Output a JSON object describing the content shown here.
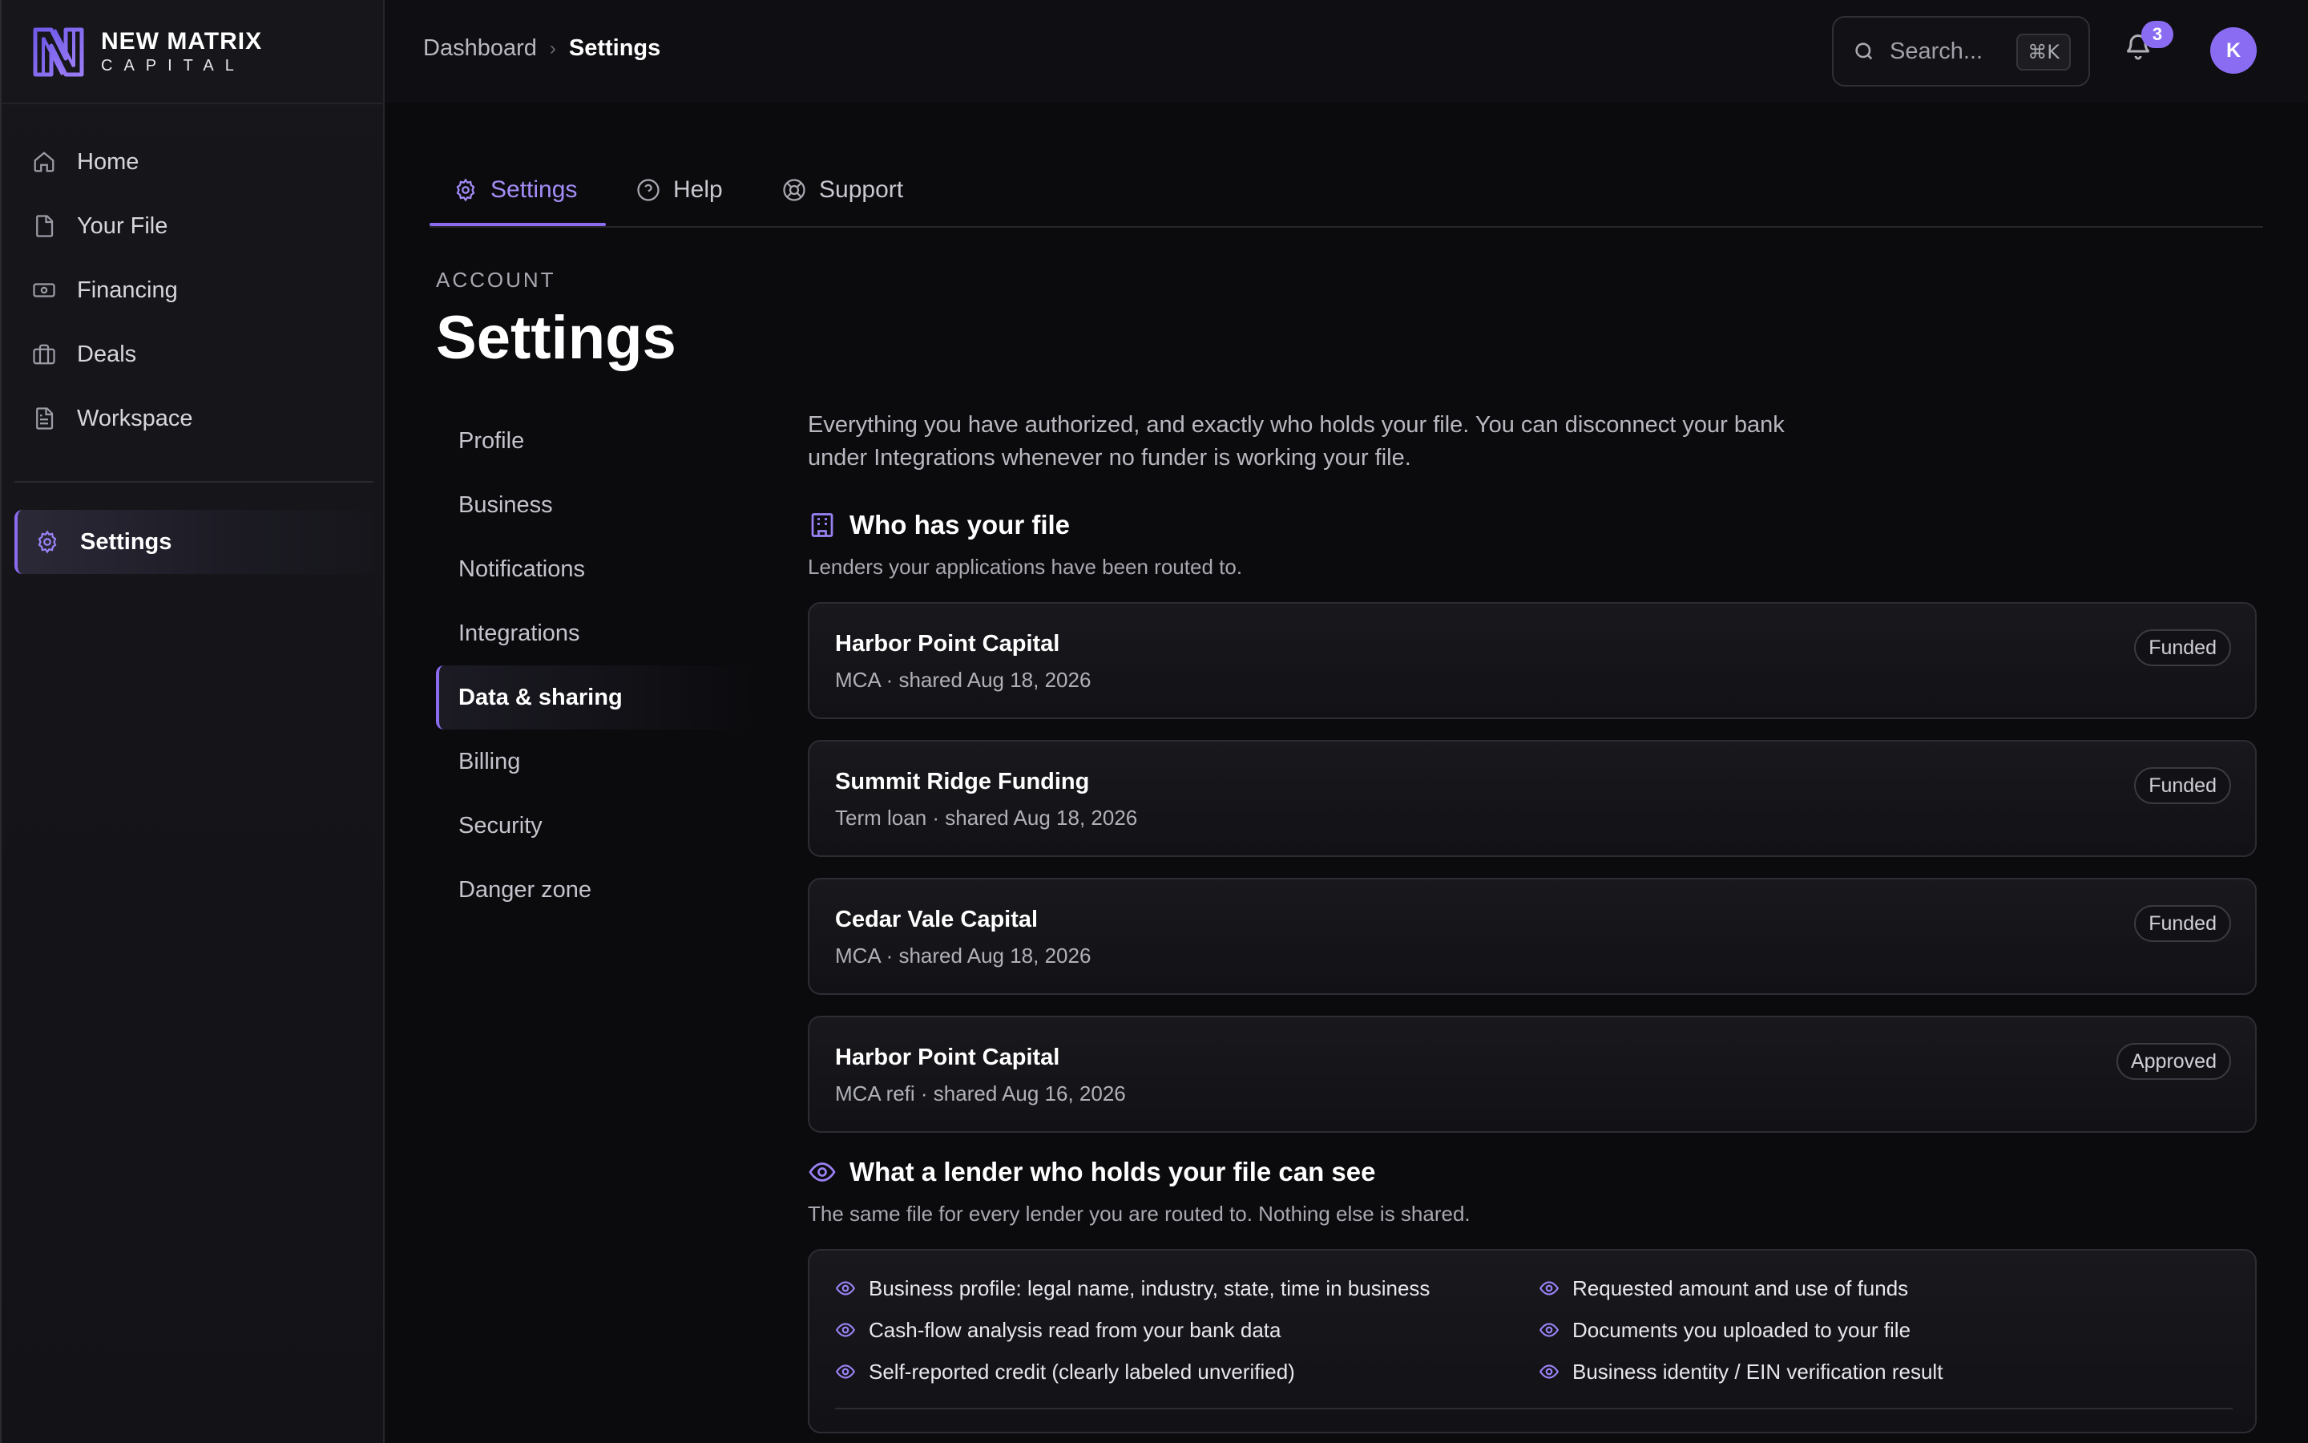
{
  "brand": {
    "name_line1": "NEW MATRIX",
    "name_line2": "CAPITAL",
    "accent": "#8b6cf0"
  },
  "sidebar": {
    "items": [
      {
        "label": "Home",
        "icon": "home-icon"
      },
      {
        "label": "Your File",
        "icon": "file-icon"
      },
      {
        "label": "Financing",
        "icon": "banknote-icon"
      },
      {
        "label": "Deals",
        "icon": "briefcase-icon"
      },
      {
        "label": "Workspace",
        "icon": "document-icon"
      }
    ],
    "active": {
      "label": "Settings",
      "icon": "gear-icon"
    }
  },
  "topbar": {
    "breadcrumb": [
      "Dashboard",
      "Settings"
    ],
    "search": {
      "placeholder": "Search...",
      "shortcut": "⌘K"
    },
    "notifications_count": "3",
    "avatar_initial": "K"
  },
  "tabs": [
    {
      "label": "Settings",
      "icon": "gear-icon",
      "active": true
    },
    {
      "label": "Help",
      "icon": "help-circle-icon",
      "active": false
    },
    {
      "label": "Support",
      "icon": "lifebuoy-icon",
      "active": false
    }
  ],
  "page": {
    "eyebrow": "ACCOUNT",
    "title": "Settings"
  },
  "subnav": [
    {
      "label": "Profile"
    },
    {
      "label": "Business"
    },
    {
      "label": "Notifications"
    },
    {
      "label": "Integrations"
    },
    {
      "label": "Data & sharing",
      "active": true
    },
    {
      "label": "Billing"
    },
    {
      "label": "Security"
    },
    {
      "label": "Danger zone"
    }
  ],
  "data_sharing": {
    "intro": "Everything you have authorized, and exactly who holds your file. You can disconnect your bank under Integrations whenever no funder is working your file.",
    "holders": {
      "title": "Who has your file",
      "subtitle": "Lenders your applications have been routed to.",
      "lenders": [
        {
          "name": "Harbor Point Capital",
          "meta": "MCA · shared Aug 18, 2026",
          "status": "Funded"
        },
        {
          "name": "Summit Ridge Funding",
          "meta": "Term loan · shared Aug 18, 2026",
          "status": "Funded"
        },
        {
          "name": "Cedar Vale Capital",
          "meta": "MCA · shared Aug 18, 2026",
          "status": "Funded"
        },
        {
          "name": "Harbor Point Capital",
          "meta": "MCA refi · shared Aug 16, 2026",
          "status": "Approved"
        }
      ]
    },
    "visibility": {
      "title": "What a lender who holds your file can see",
      "subtitle": "The same file for every lender you are routed to. Nothing else is shared.",
      "items": [
        "Business profile: legal name, industry, state, time in business",
        "Requested amount and use of funds",
        "Cash-flow analysis read from your bank data",
        "Documents you uploaded to your file",
        "Self-reported credit (clearly labeled unverified)",
        "Business identity / EIN verification result"
      ]
    }
  }
}
